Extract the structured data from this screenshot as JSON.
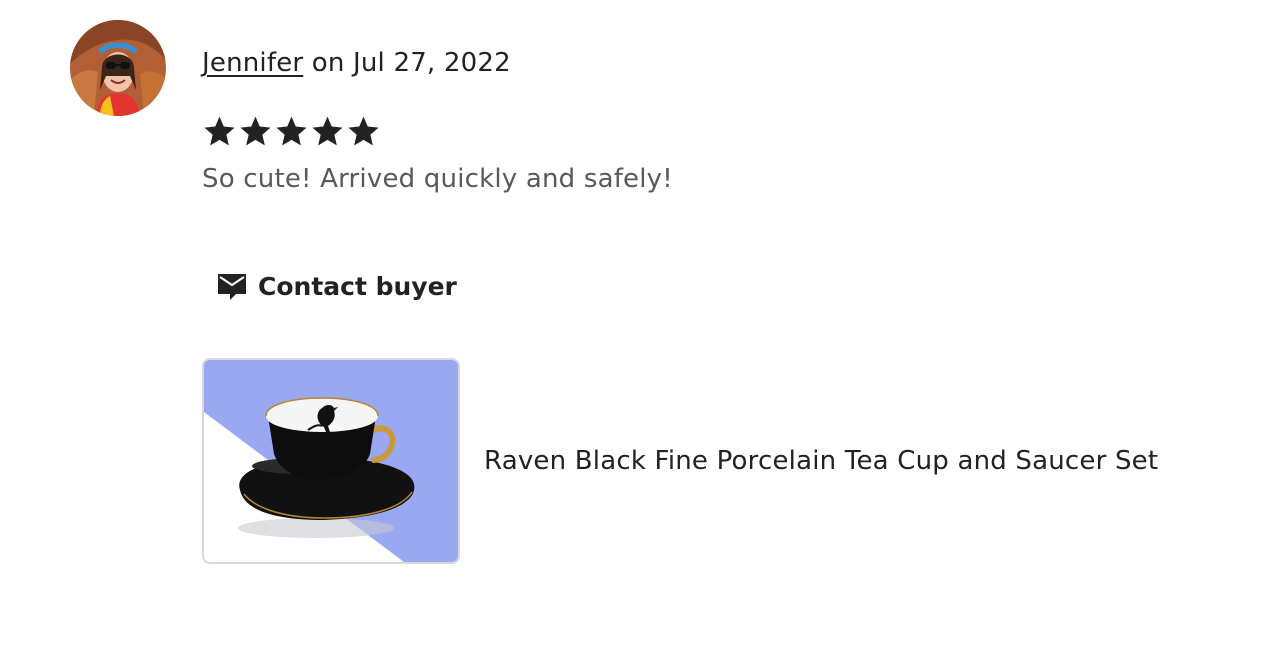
{
  "review": {
    "reviewer_name": "Jennifer",
    "date_text": " on Jul 27, 2022",
    "rating": 5,
    "rating_max": 5,
    "text": "So cute! Arrived quickly and safely!"
  },
  "actions": {
    "contact_buyer_label": "Contact buyer",
    "contact_icon": "message-icon"
  },
  "product": {
    "title": "Raven Black Fine Porcelain Tea Cup and Saucer Set"
  },
  "colors": {
    "text_primary": "#222222",
    "text_secondary": "#595959",
    "star": "#222222",
    "thumb_background": "#9aa7f2"
  }
}
